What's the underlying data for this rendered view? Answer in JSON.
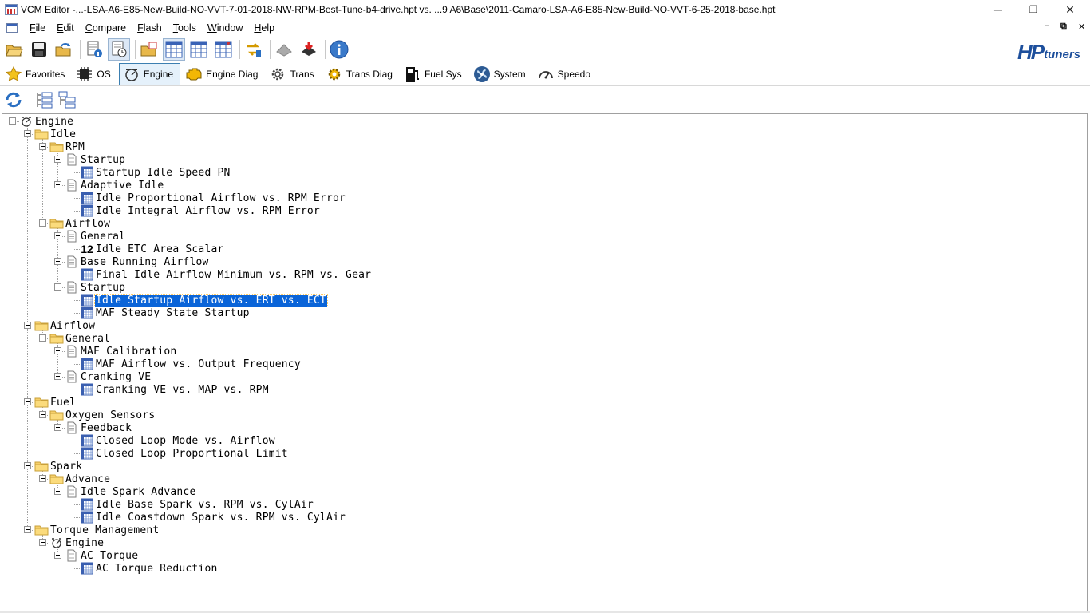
{
  "window": {
    "title": "VCM Editor -...-LSA-A6-E85-New-Build-NO-VVT-7-01-2018-NW-RPM-Best-Tune-b4-drive.hpt vs. ...9 A6\\Base\\2011-Camaro-LSA-A6-E85-New-Build-NO-VVT-6-25-2018-base.hpt",
    "minimize": "─",
    "restore": "❐",
    "close": "✕"
  },
  "menu": {
    "items": [
      {
        "acc": "F",
        "rest": "ile"
      },
      {
        "acc": "E",
        "rest": "dit"
      },
      {
        "acc": "C",
        "rest": "ompare"
      },
      {
        "acc": "F",
        "rest": "lash"
      },
      {
        "acc": "T",
        "rest": "ools"
      },
      {
        "acc": "W",
        "rest": "indow"
      },
      {
        "acc": "H",
        "rest": "elp"
      }
    ],
    "mdi_minimize": "−",
    "mdi_restore": "⧉",
    "mdi_close": "✕"
  },
  "toolbar": {
    "icons": [
      "open-folder-icon",
      "save-icon",
      "open-recent-icon",
      "vehicle-info-icon",
      "compare-icon",
      "open-compare-icon",
      "table-view-icon",
      "table-edit-icon",
      "table-compare-icon",
      "swap-icon",
      "read-icon",
      "write-icon",
      "info-icon"
    ]
  },
  "logo": {
    "hp": "HP",
    "tuners": "tuners"
  },
  "categories": [
    {
      "label": "Favorites",
      "icon": "star-icon"
    },
    {
      "label": "OS",
      "icon": "chip-icon"
    },
    {
      "label": "Engine",
      "icon": "engine-icon",
      "active": true
    },
    {
      "label": "Engine Diag",
      "icon": "check-engine-icon"
    },
    {
      "label": "Trans",
      "icon": "gear-icon"
    },
    {
      "label": "Trans Diag",
      "icon": "trans-diag-icon"
    },
    {
      "label": "Fuel Sys",
      "icon": "fuel-pump-icon"
    },
    {
      "label": "System",
      "icon": "fan-icon"
    },
    {
      "label": "Speedo",
      "icon": "speedometer-icon"
    }
  ],
  "tree": {
    "nodes": [
      {
        "label": "Engine",
        "depth": 0,
        "icon": "engine"
      },
      {
        "label": "Idle",
        "depth": 1,
        "icon": "folder"
      },
      {
        "label": "RPM",
        "depth": 2,
        "icon": "folder"
      },
      {
        "label": "Startup",
        "depth": 3,
        "icon": "page"
      },
      {
        "label": "Startup Idle Speed PN",
        "depth": 4,
        "icon": "table"
      },
      {
        "label": "Adaptive Idle",
        "depth": 3,
        "icon": "page"
      },
      {
        "label": "Idle Proportional Airflow vs. RPM Error",
        "depth": 4,
        "icon": "table"
      },
      {
        "label": "Idle Integral Airflow vs. RPM Error",
        "depth": 4,
        "icon": "table"
      },
      {
        "label": "Airflow",
        "depth": 2,
        "icon": "folder"
      },
      {
        "label": "General",
        "depth": 3,
        "icon": "page"
      },
      {
        "label": "Idle ETC Area Scalar",
        "depth": 4,
        "icon": "scalar"
      },
      {
        "label": "Base Running Airflow",
        "depth": 3,
        "icon": "page"
      },
      {
        "label": "Final Idle Airflow Minimum vs. RPM vs. Gear",
        "depth": 4,
        "icon": "table"
      },
      {
        "label": "Startup",
        "depth": 3,
        "icon": "page"
      },
      {
        "label": "Idle Startup Airflow vs. ERT vs. ECT",
        "depth": 4,
        "icon": "table",
        "selected": true
      },
      {
        "label": "MAF Steady State Startup",
        "depth": 4,
        "icon": "table"
      },
      {
        "label": "Airflow",
        "depth": 1,
        "icon": "folder"
      },
      {
        "label": "General",
        "depth": 2,
        "icon": "folder"
      },
      {
        "label": "MAF Calibration",
        "depth": 3,
        "icon": "page"
      },
      {
        "label": "MAF Airflow vs. Output Frequency",
        "depth": 4,
        "icon": "table"
      },
      {
        "label": "Cranking VE",
        "depth": 3,
        "icon": "page"
      },
      {
        "label": "Cranking VE vs. MAP vs. RPM",
        "depth": 4,
        "icon": "table"
      },
      {
        "label": "Fuel",
        "depth": 1,
        "icon": "folder"
      },
      {
        "label": "Oxygen Sensors",
        "depth": 2,
        "icon": "folder"
      },
      {
        "label": "Feedback",
        "depth": 3,
        "icon": "page"
      },
      {
        "label": "Closed Loop Mode vs. Airflow",
        "depth": 4,
        "icon": "table"
      },
      {
        "label": "Closed Loop Proportional Limit",
        "depth": 4,
        "icon": "table"
      },
      {
        "label": "Spark",
        "depth": 1,
        "icon": "folder"
      },
      {
        "label": "Advance",
        "depth": 2,
        "icon": "folder"
      },
      {
        "label": "Idle Spark Advance",
        "depth": 3,
        "icon": "page"
      },
      {
        "label": "Idle Base Spark vs. RPM vs. CylAir",
        "depth": 4,
        "icon": "table"
      },
      {
        "label": "Idle Coastdown Spark vs. RPM vs. CylAir",
        "depth": 4,
        "icon": "table"
      },
      {
        "label": "Torque Management",
        "depth": 1,
        "icon": "folder"
      },
      {
        "label": "Engine",
        "depth": 2,
        "icon": "engine"
      },
      {
        "label": "AC Torque",
        "depth": 3,
        "icon": "page"
      },
      {
        "label": "AC Torque Reduction",
        "depth": 4,
        "icon": "table"
      }
    ],
    "scalar_glyph": "12"
  }
}
